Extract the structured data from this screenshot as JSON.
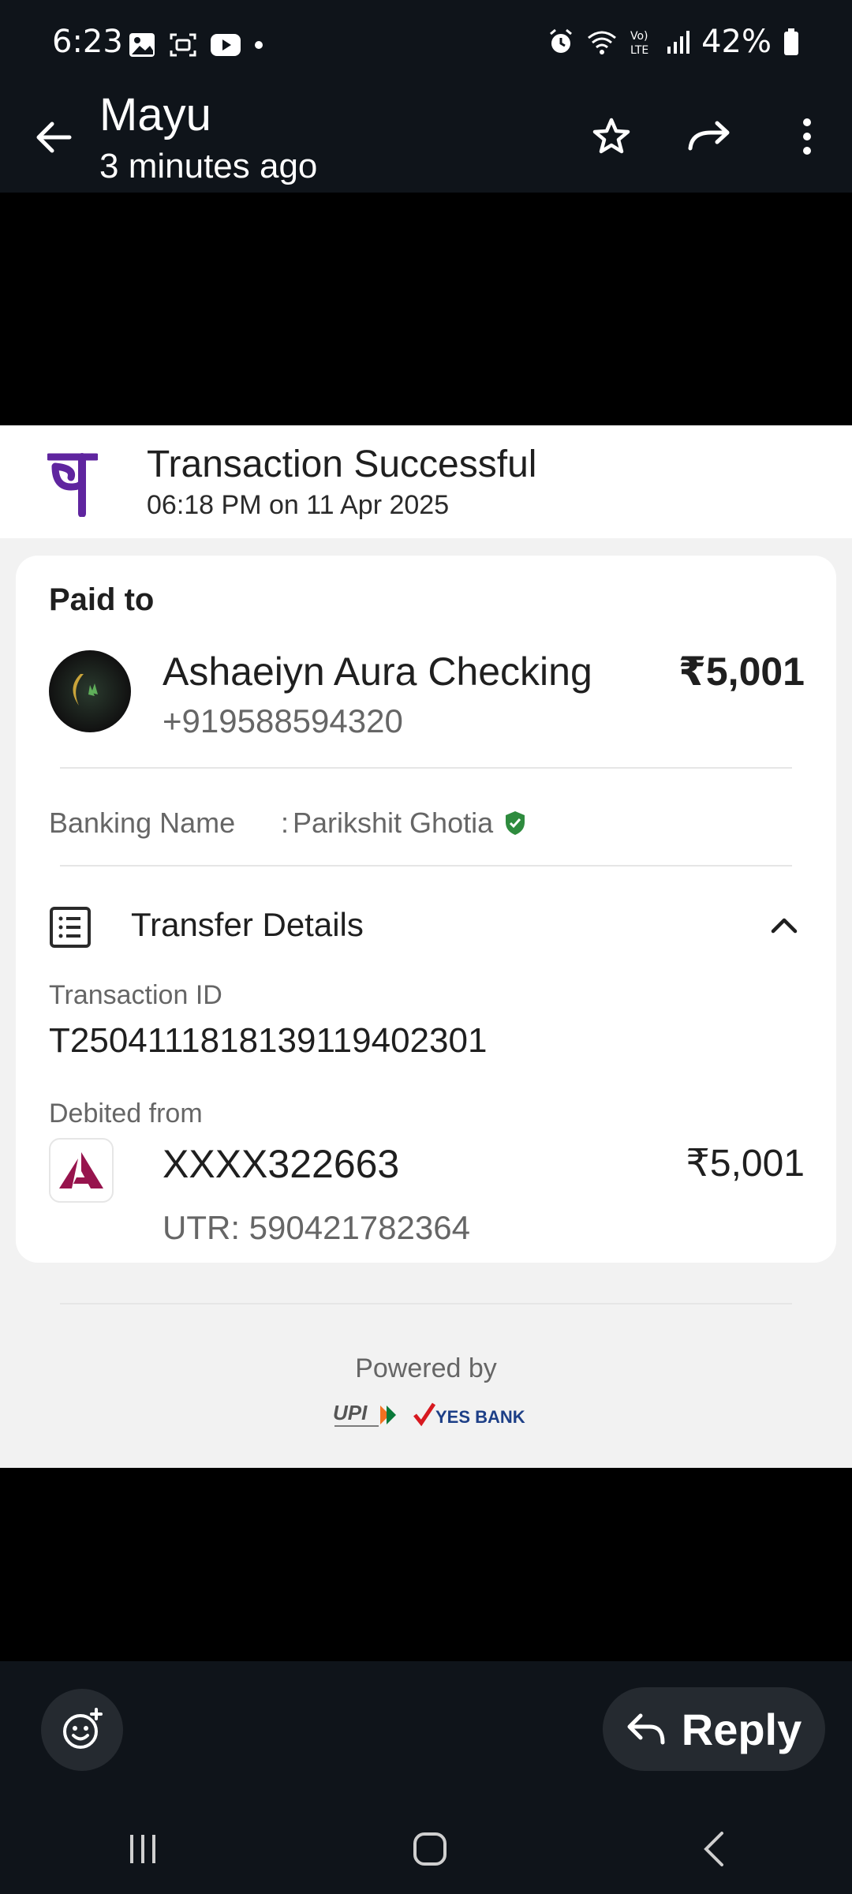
{
  "status_bar": {
    "time": "6:23",
    "battery": "42%"
  },
  "header": {
    "sender": "Mayu",
    "timestamp": "3 minutes ago"
  },
  "receipt": {
    "title": "Transaction Successful",
    "datetime": "06:18 PM on 11 Apr 2025",
    "paid_to_label": "Paid to",
    "payee": {
      "name": "Ashaeiyn Aura Checking",
      "phone": "+919588594320",
      "amount": "₹5,001"
    },
    "banking_name_label": "Banking Name",
    "banking_name_colon": ":",
    "banking_name_value": "Parikshit Ghotia",
    "transfer_details_label": "Transfer Details",
    "transaction_id_label": "Transaction ID",
    "transaction_id": "T2504111818139119402301",
    "debited_from_label": "Debited from",
    "account": {
      "number": "XXXX322663",
      "amount": "₹5,001",
      "utr": "UTR: 590421782364"
    },
    "powered_by": "Powered by",
    "partner_logos": [
      "UPI",
      "YES BANK"
    ]
  },
  "footer": {
    "reply_label": "Reply"
  },
  "colors": {
    "phonepe_purple": "#5f259f",
    "verified_green": "#2e8b3e",
    "axis_red": "#97144d"
  }
}
